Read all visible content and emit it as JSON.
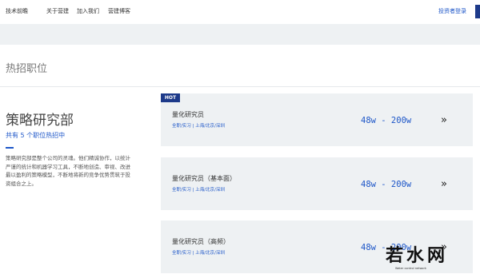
{
  "nav": {
    "items": [
      "技术前瞻",
      "关于营建",
      "加入我们",
      "营建博客"
    ],
    "right_link": "投资者登录"
  },
  "section_title": "热招职位",
  "department": {
    "title": "策略研究部",
    "subtitle": "共有 5 个职位热招中",
    "description": "策略研究部是整个公司的灵魂。他们精诚协作，以统计严谨的统计和机器学习工具，不断地创造、审视、改进最以盈利的策略模型，不断地将新的竞争优势贯筑于投资组合之上。"
  },
  "hot_badge": "HOT",
  "jobs": [
    {
      "title": "量化研究员",
      "meta": "全职/实习 | 上海/北京/深圳",
      "salary": "48w - 200w",
      "arrow": "»"
    },
    {
      "title": "量化研究员（基本面）",
      "meta": "全职/实习 | 上海/北京/深圳",
      "salary": "48w - 200w",
      "arrow": "»"
    },
    {
      "title": "量化研究员（高频）",
      "meta": "全职/实习 | 上海/北京/深圳",
      "salary": "48w - 200w",
      "arrow": "»"
    }
  ],
  "watermark": {
    "text": "若水网",
    "subtext": "Water   control   network"
  },
  "colors": {
    "accent": "#1d56c8",
    "badge": "#1d3a8a",
    "card_bg": "#eef1f3"
  }
}
